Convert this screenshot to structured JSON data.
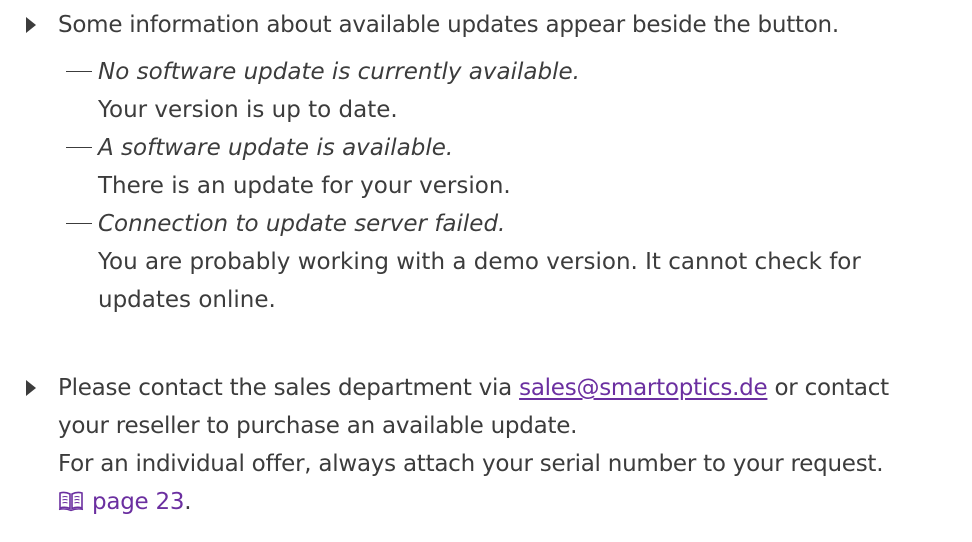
{
  "items": [
    {
      "text": "Some information about available updates appear beside the button."
    },
    {
      "status": [
        {
          "title": "No software update is currently available.",
          "description": "Your version is up to date."
        },
        {
          "title": "A software update is available.",
          "description": "There is an update for your version."
        },
        {
          "title": "Connection to update server failed.",
          "description_line1": "You are probably working with a demo version. It cannot check for",
          "description_line2": "updates online."
        }
      ]
    },
    {
      "text_before_link": "Please contact the sales department via ",
      "email_link": "sales@smartoptics.de",
      "text_after_link": " or contact",
      "line2": "your reseller to purchase an available update.",
      "line3": "For an individual offer, always attach your serial number to your request.",
      "page_ref": "page 23",
      "page_ref_suffix": "."
    }
  ],
  "colors": {
    "text": "#3c3c3c",
    "link": "#6b2fa0"
  },
  "icons": {
    "bullet": "triangle-bullet-icon",
    "book": "book-icon"
  }
}
